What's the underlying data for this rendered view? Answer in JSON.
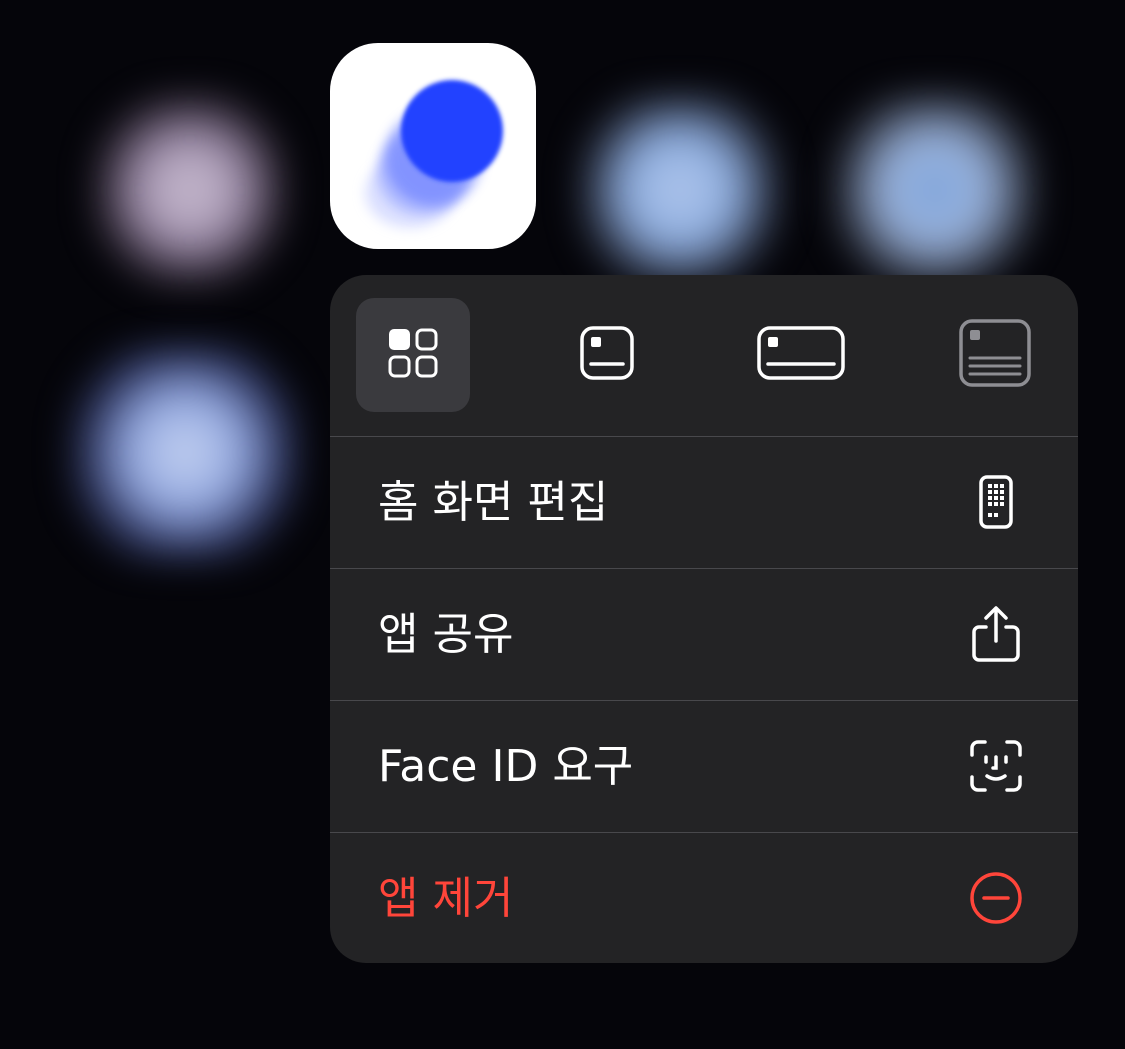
{
  "background": {
    "icons": [
      "blurred-app-icon",
      "blurred-app-icon",
      "blurred-app-icon",
      "blurred-app-icon"
    ]
  },
  "app_icon": {
    "name": "app-icon",
    "accent": "#2142ff"
  },
  "context_menu": {
    "widget_sizes": [
      {
        "icon": "small-grid-icon",
        "selected": true
      },
      {
        "icon": "medium-widget-icon",
        "selected": false
      },
      {
        "icon": "wide-widget-icon",
        "selected": false
      },
      {
        "icon": "large-widget-icon",
        "selected": false
      }
    ],
    "items": [
      {
        "label": "홈 화면 편집",
        "icon": "phone-grid-icon",
        "destructive": false
      },
      {
        "label": "앱 공유",
        "icon": "share-icon",
        "destructive": false
      },
      {
        "label": "Face ID 요구",
        "icon": "face-id-icon",
        "destructive": false
      },
      {
        "label": "앱 제거",
        "icon": "minus-circle-icon",
        "destructive": true
      }
    ],
    "colors": {
      "menu_background": "#232325",
      "text": "#ffffff",
      "destructive": "#ff453a",
      "selected_background": "#3a3a3e"
    }
  }
}
